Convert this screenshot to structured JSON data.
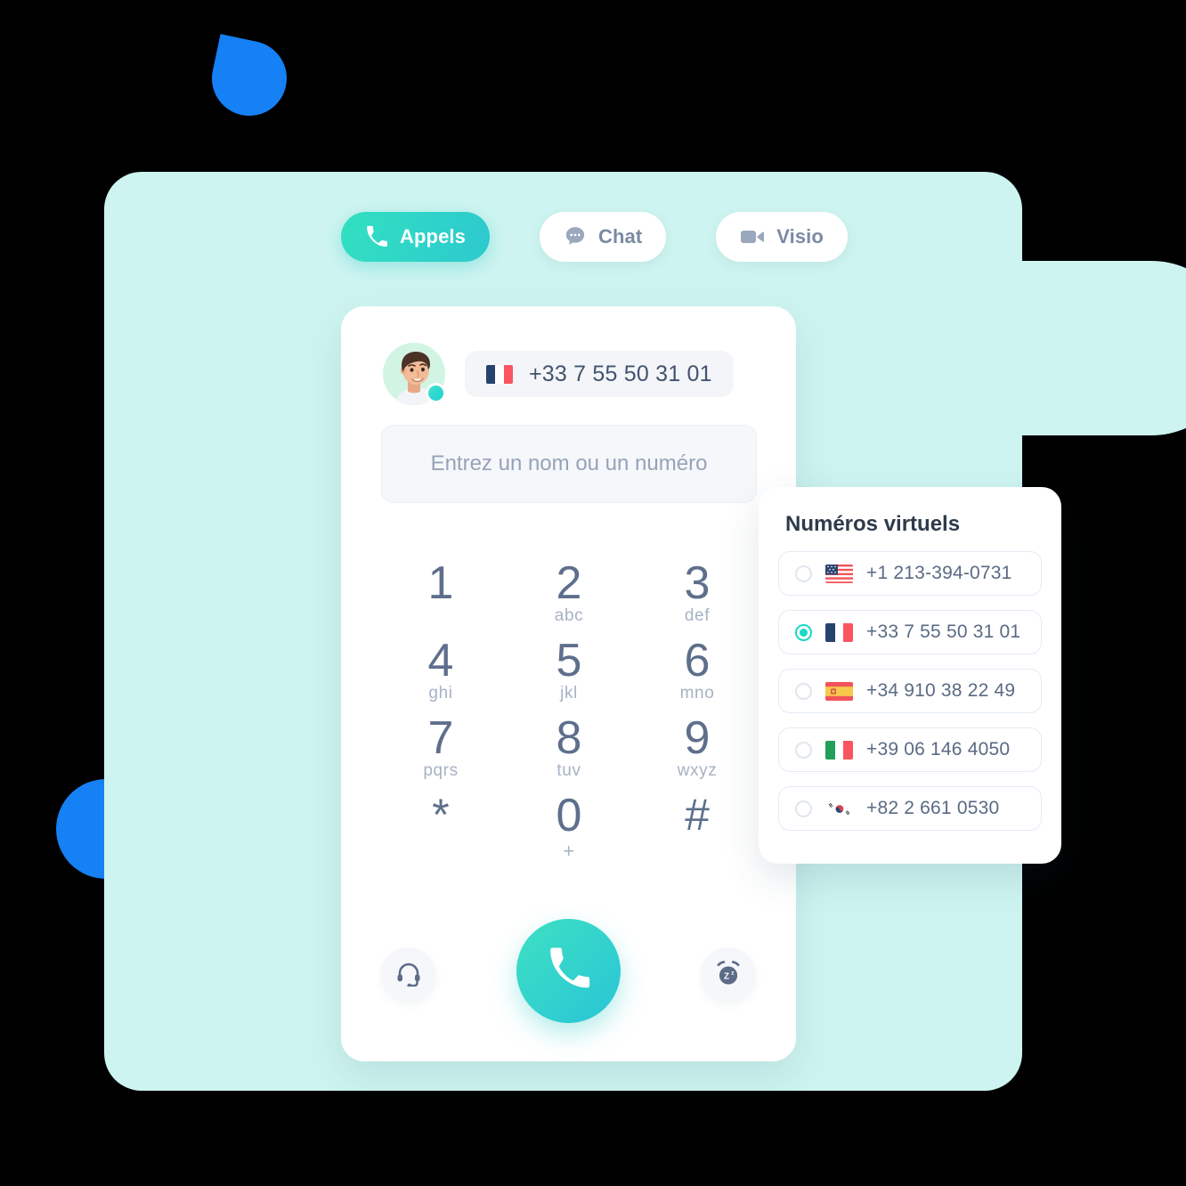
{
  "colors": {
    "mint_panel": "#cdf4f0",
    "accent_teal": "#2dc9cf",
    "accent_blue": "#1680f5",
    "text_dark": "#2e3a4b",
    "text_muted": "#97a3b8",
    "digit": "#5e6f8c"
  },
  "tabs": [
    {
      "label": "Appels",
      "icon": "phone-icon",
      "active": true
    },
    {
      "label": "Chat",
      "icon": "chat-bubble-icon",
      "active": false
    },
    {
      "label": "Visio",
      "icon": "video-camera-icon",
      "active": false
    }
  ],
  "caller": {
    "avatar_icon": "user-avatar-photo",
    "status_icon": "online-status-dot",
    "flag_icon": "flag-fr",
    "number": "+33 7 55 50 31 01"
  },
  "search": {
    "placeholder": "Entrez un nom ou un numéro",
    "value": ""
  },
  "keypad": [
    {
      "digit": "1",
      "sub": ""
    },
    {
      "digit": "2",
      "sub": "abc"
    },
    {
      "digit": "3",
      "sub": "def"
    },
    {
      "digit": "4",
      "sub": "ghi"
    },
    {
      "digit": "5",
      "sub": "jkl"
    },
    {
      "digit": "6",
      "sub": "mno"
    },
    {
      "digit": "7",
      "sub": "pqrs"
    },
    {
      "digit": "8",
      "sub": "tuv"
    },
    {
      "digit": "9",
      "sub": "wxyz"
    },
    {
      "digit": "*",
      "sub": ""
    },
    {
      "digit": "0",
      "sub": "+"
    },
    {
      "digit": "#",
      "sub": ""
    }
  ],
  "actions": {
    "headset_icon": "headset-icon",
    "call_icon": "phone-icon",
    "snooze_icon": "alarm-snooze-icon"
  },
  "virtual_numbers": {
    "title": "Numéros virtuels",
    "items": [
      {
        "flag": "flag-us",
        "number": "+1 213-394-0731",
        "selected": false
      },
      {
        "flag": "flag-fr",
        "number": "+33 7 55 50 31 01",
        "selected": true
      },
      {
        "flag": "flag-es",
        "number": "+34 910 38 22 49",
        "selected": false
      },
      {
        "flag": "flag-it",
        "number": "+39 06 146 4050",
        "selected": false
      },
      {
        "flag": "flag-kr",
        "number": "+82 2 661 0530",
        "selected": false
      }
    ]
  }
}
